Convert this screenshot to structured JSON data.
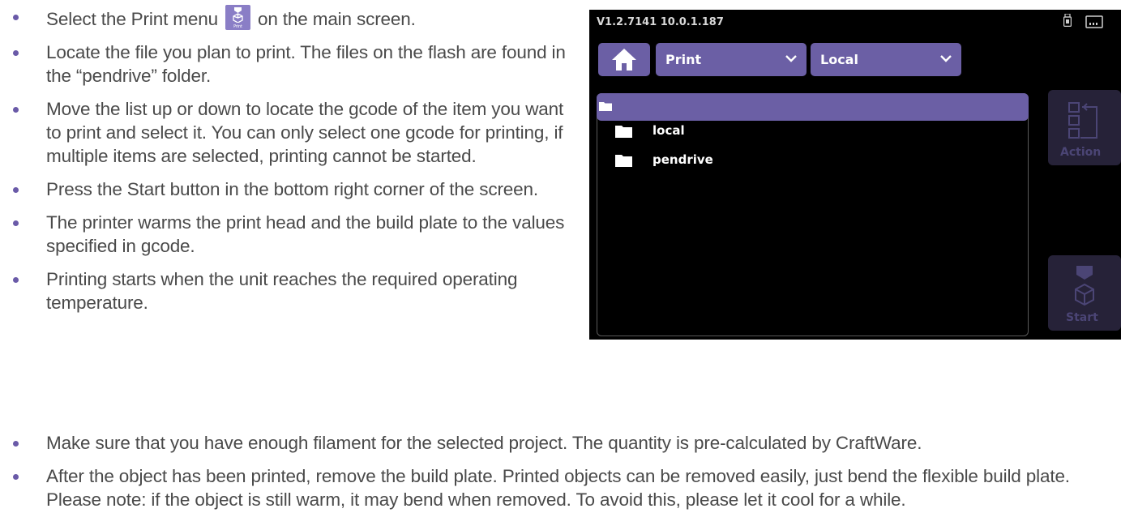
{
  "instructions": {
    "steps": [
      {
        "before_icon": "Select the Print menu",
        "icon": "print-menu-icon",
        "icon_label": "Print",
        "after_icon": "on the main screen."
      },
      {
        "text": "Locate the file you plan to print. The files on the flash are found in the “pendrive” folder."
      },
      {
        "text": "Move the list up or down to locate the gcode of the item you want to print and select it. You can only select one gcode for printing, if multiple items are selected, printing cannot be started."
      },
      {
        "text": "Press the Start button in the bottom right corner of the screen."
      },
      {
        "text": "The printer warms the print head and the build plate to the values specified in gcode."
      },
      {
        "text": "Printing starts when the unit reaches the required operating temperature."
      }
    ],
    "notes": [
      {
        "text": "Make sure that you have enough filament for the selected project. The quantity is pre-calculated by CraftWare."
      },
      {
        "text": "After the object has been printed, remove the build plate. Printed objects can be removed easily, just bend the flexible build plate. Please note: if the object is still warm, it may bend when removed. To avoid this, please let it cool for a while."
      }
    ]
  },
  "printer_screen": {
    "status_bar": {
      "version_ip": "V1.2.7141 10.0.1.187",
      "icons": [
        "usb-icon",
        "network-icon"
      ]
    },
    "home_button": {
      "icon": "home-icon"
    },
    "mode_dropdown": {
      "value": "Print"
    },
    "source_dropdown": {
      "value": "Local"
    },
    "file_list": {
      "current_folder_icon": "folder-icon",
      "items": [
        "local",
        "pendrive"
      ]
    },
    "action_button": {
      "label": "Action",
      "icon": "action-icon"
    },
    "start_button": {
      "label": "Start",
      "icon": "print-head-icon"
    }
  },
  "colors": {
    "accent_purple": "#6b5fa5",
    "bullet_purple": "#6a5aa8",
    "disabled_button_bg": "#262238",
    "disabled_button_text": "#4b4575",
    "screen_bg": "#000000",
    "body_text": "#4a4a4a"
  }
}
